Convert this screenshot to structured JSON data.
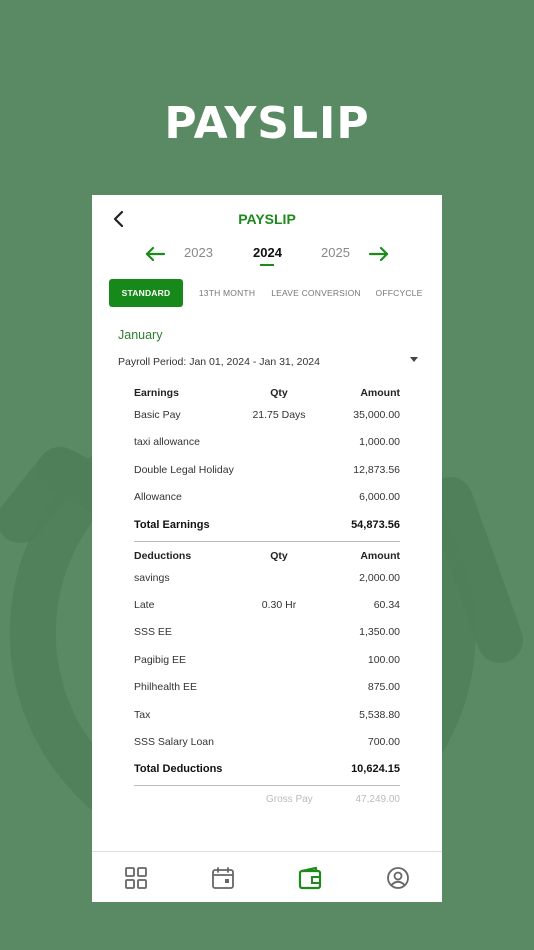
{
  "hero": {
    "title": "PAYSLIP"
  },
  "app": {
    "title": "PAYSLIP"
  },
  "years": {
    "prev": "2023",
    "current": "2024",
    "next": "2025"
  },
  "tabs": [
    {
      "label": "STANDARD",
      "active": true
    },
    {
      "label": "13TH MONTH",
      "active": false
    },
    {
      "label": "LEAVE CONVERSION",
      "active": false
    },
    {
      "label": "OFFCYCLE",
      "active": false
    }
  ],
  "payslip": {
    "month": "January",
    "period": "Payroll Period: Jan 01, 2024 - Jan 31, 2024",
    "earnings": {
      "header": {
        "name": "Earnings",
        "qty": "Qty",
        "amount": "Amount"
      },
      "items": [
        {
          "name": "Basic Pay",
          "qty": "21.75 Days",
          "amount": "35,000.00"
        },
        {
          "name": "taxi allowance",
          "qty": "",
          "amount": "1,000.00"
        },
        {
          "name": "Double Legal Holiday",
          "qty": "",
          "amount": "12,873.56"
        },
        {
          "name": "Allowance",
          "qty": "",
          "amount": "6,000.00"
        }
      ],
      "total": {
        "label": "Total Earnings",
        "amount": "54,873.56"
      }
    },
    "deductions": {
      "header": {
        "name": "Deductions",
        "qty": "Qty",
        "amount": "Amount"
      },
      "items": [
        {
          "name": "savings",
          "qty": "",
          "amount": "2,000.00"
        },
        {
          "name": "Late",
          "qty": "0.30 Hr",
          "amount": "60.34"
        },
        {
          "name": "SSS EE",
          "qty": "",
          "amount": "1,350.00"
        },
        {
          "name": "Pagibig EE",
          "qty": "",
          "amount": "100.00"
        },
        {
          "name": "Philhealth EE",
          "qty": "",
          "amount": "875.00"
        },
        {
          "name": "Tax",
          "qty": "",
          "amount": "5,538.80"
        },
        {
          "name": "SSS Salary Loan",
          "qty": "",
          "amount": "700.00"
        }
      ],
      "total": {
        "label": "Total Deductions",
        "amount": "10,624.15"
      }
    },
    "partial": {
      "label": "Gross Pay",
      "amount": "47,249.00"
    }
  },
  "nav": [
    {
      "icon": "dashboard-grid-icon",
      "active": false
    },
    {
      "icon": "calendar-icon",
      "active": false
    },
    {
      "icon": "wallet-icon",
      "active": true
    },
    {
      "icon": "profile-icon",
      "active": false
    }
  ],
  "colors": {
    "background": "#5a8a63",
    "accent": "#1e8a1e",
    "tab_active": "#16891a"
  }
}
